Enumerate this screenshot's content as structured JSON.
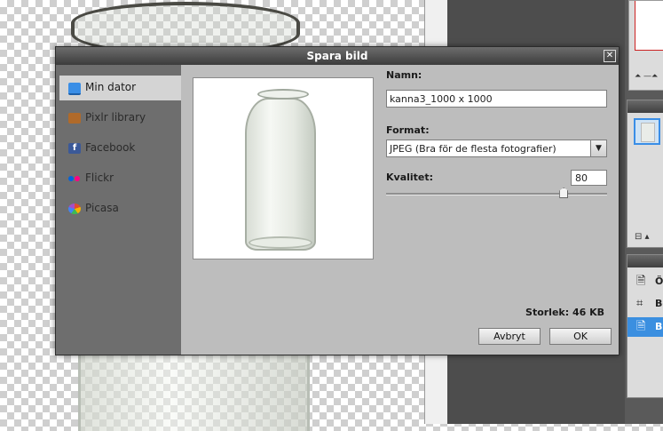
{
  "dialog": {
    "title": "Spara bild",
    "close_symbol": "✕"
  },
  "sidebar": {
    "items": [
      {
        "label": "Min dator",
        "icon": "monitor-icon",
        "color": "#3a8ee6",
        "active": true
      },
      {
        "label": "Pixlr library",
        "icon": "library-icon",
        "color": "#b06a2a",
        "active": false
      },
      {
        "label": "Facebook",
        "icon": "facebook-icon",
        "color": "#3b5998",
        "active": false
      },
      {
        "label": "Flickr",
        "icon": "flickr-icon",
        "color": "#ff0084",
        "active": false
      },
      {
        "label": "Picasa",
        "icon": "picasa-icon",
        "color": "#e04a2f",
        "active": false
      }
    ]
  },
  "form": {
    "name_label": "Namn:",
    "name_value": "kanna3_1000 x 1000",
    "format_label": "Format:",
    "format_value": "JPEG (Bra för de flesta fotografier)",
    "quality_label": "Kvalitet:",
    "quality_value": "80",
    "quality_fraction": 0.8,
    "size_text": "Storlek: 46 KB",
    "cancel_label": "Avbryt",
    "ok_label": "OK"
  },
  "history": {
    "items": [
      {
        "text": "Ö",
        "icon": "document-edit-icon",
        "active": false
      },
      {
        "text": "Be",
        "icon": "crop-icon",
        "active": false
      },
      {
        "text": "Bi",
        "icon": "document-edit-icon",
        "active": true
      }
    ]
  },
  "navigator": {
    "zoom_controls": "⏶ —⏶"
  },
  "layers": {
    "footer": "⊟ ▴"
  },
  "colors": {
    "accent": "#3b8fe0",
    "sidebar_bg": "#6e6e6e",
    "dialog_bg": "#bdbdbd"
  }
}
